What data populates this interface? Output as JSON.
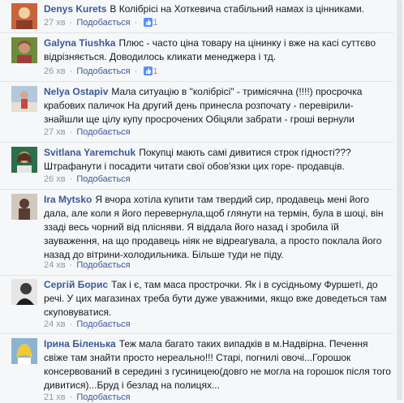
{
  "comments": [
    {
      "author": "Denys Kurets",
      "text": "В Колібрісі на Хоткевича стабільний намах із цінниками.",
      "time": "27 хв",
      "like_label": "Подобається",
      "likes": "1",
      "avatar_colors": {
        "bg": "#c8643c",
        "fg": "#f0d2a0"
      }
    },
    {
      "author": "Galyna Tiushka",
      "text": "Плюс - часто ціна товару на цінинку і вже на касі суттєво відрізняється. Доводилось кликати менеджера і тд.",
      "time": "26 хв",
      "like_label": "Подобається",
      "likes": "1",
      "avatar_colors": {
        "bg": "#6e8c3c",
        "fg": "#c89678"
      }
    },
    {
      "author": "Nelya Ostapiv",
      "text": "Мала ситуацію в \"колібрісі\" - тримісячна (!!!!) просрочка крабових паличок На другий день принесла розпочату - перевірили- знайшли ще цілу купу просрочених Обіцяли забрати - гроші вернули",
      "time": "27 хв",
      "like_label": "Подобається",
      "likes": "",
      "avatar_colors": {
        "bg": "#b4c8dc",
        "fg": "#c84646"
      }
    },
    {
      "author": "Svitlana Yaremchuk",
      "text": "Покупці мають самі дивитися строк гідності??? Штрафанути і посадити читати свої обов'язки цих горе- продавців.",
      "time": "26 хв",
      "like_label": "Подобається",
      "likes": "",
      "avatar_colors": {
        "bg": "#2d6e4b",
        "fg": "#dcb48c"
      }
    },
    {
      "author": "Ira Mytsko",
      "text": "Я вчора хотіла купити там твердий сир, продавець мені його дала, але коли я його перевернула,щоб глянути на термін, була в шоці, він ззаді весь чорний від плісняви. Я віддала його назад і зробила їй зауваження, на що продавець ніяк не відреагувала, а просто поклала його назад до вітрини-холодильника. Більше туди не піду.",
      "time": "24 хв",
      "like_label": "Подобається",
      "likes": "",
      "avatar_colors": {
        "bg": "#d2c8be",
        "fg": "#5a3c32"
      }
    },
    {
      "author": "Сергій Борис",
      "text": "Так і є, там маса прострочки. Як і в сусідньому Фуршеті, до речі. У цих магазинах треба бути дуже уважними, якщо вже доведеться там скуповуватися.",
      "time": "24 хв",
      "like_label": "Подобається",
      "likes": "",
      "avatar_colors": {
        "bg": "#e6e6e6",
        "fg": "#3c3c3c"
      }
    },
    {
      "author": "Ірина Біленька",
      "text": "Теж мала багато таких випадків в м.Надвірна. Печення свіже там знайти просто нереально!!! Старі, погнилі овочі...Горошок консервований в середині з гусиницею(довго не могла на горошок після того дивитися)...Бруд і безлад на полицях...",
      "time": "21 хв",
      "like_label": "Подобається",
      "likes": "",
      "avatar_colors": {
        "bg": "#8cb4d2",
        "fg": "#f0c83c"
      }
    }
  ]
}
